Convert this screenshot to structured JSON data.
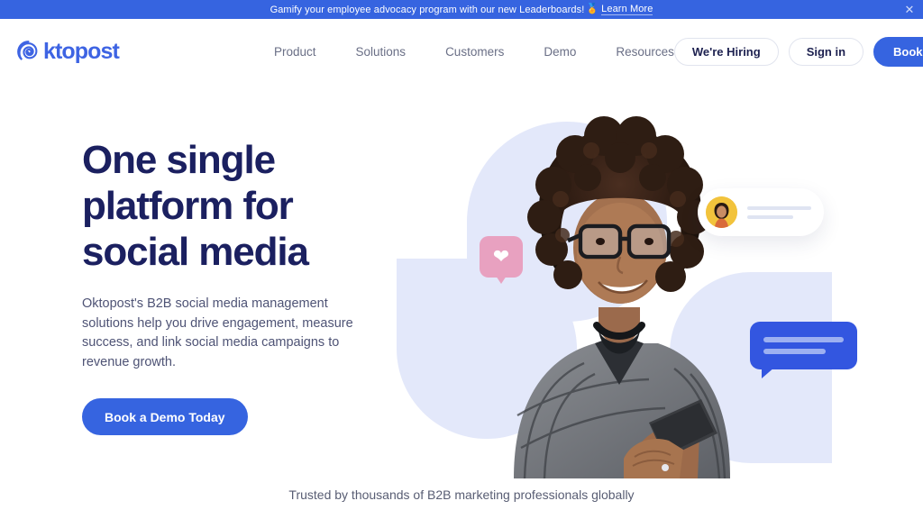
{
  "banner": {
    "text": "Gamify your employee advocacy program with our new Leaderboards!",
    "emoji": "🏅",
    "link_label": "Learn More",
    "close_icon": "close-icon",
    "background_color": "#3664e0"
  },
  "header": {
    "logo_text": "ktopost",
    "logo_mark": "oktopost-spiral-icon",
    "brand_color": "#3e64e3",
    "nav": [
      {
        "label": "Product"
      },
      {
        "label": "Solutions"
      },
      {
        "label": "Customers"
      },
      {
        "label": "Demo"
      },
      {
        "label": "Resources"
      }
    ],
    "actions": {
      "hiring_label": "We're Hiring",
      "signin_label": "Sign in",
      "demo_label": "Book a Demo"
    }
  },
  "hero": {
    "title": "One single platform for social media",
    "subtitle": "Oktopost's B2B social media management solutions help you drive engagement, measure success, and link social media campaigns to revenue growth.",
    "cta_label": "Book a Demo Today",
    "title_color": "#1b2060",
    "accent_color": "#3664e0",
    "art": {
      "person_alt": "smiling-woman-with-glasses-holding-phone",
      "heart_badge": "heart-icon",
      "heart_color": "#e8a1c0",
      "notification_card": "notification-card",
      "avatar": "user-avatar",
      "chat_bubble": "chat-bubble",
      "chat_bubble_color": "#3356e0",
      "blob_color": "#e3e8fa"
    }
  },
  "trust": {
    "text": "Trusted by thousands of B2B marketing professionals globally"
  }
}
